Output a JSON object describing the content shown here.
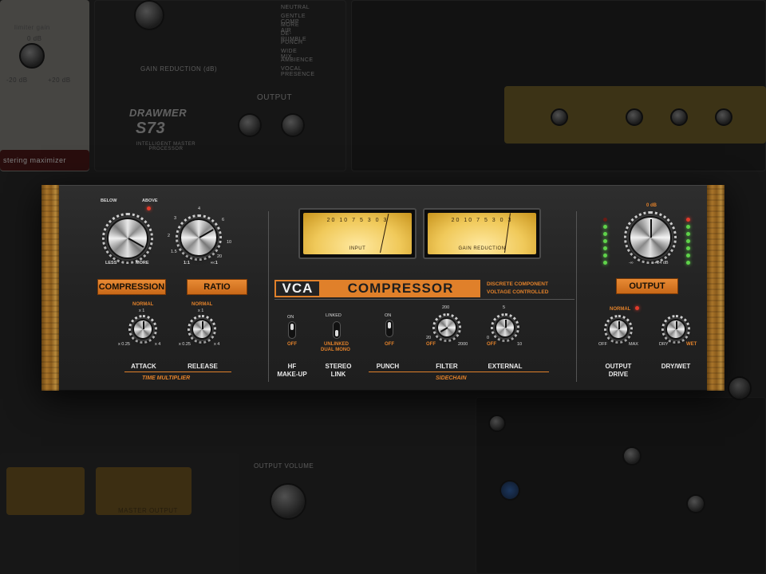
{
  "colors": {
    "accent": "#e0802a",
    "plate": "#d9762a",
    "led_green": "#5fd34a",
    "led_red": "#e23b2b",
    "meter": "#f0c95a"
  },
  "background": {
    "limiter_gain": "limiter gain",
    "limiter_gain_value": "0 dB",
    "limiter_minus": "-20 dB",
    "limiter_plus": "+20 dB",
    "mastering": "stering maximizer",
    "drawmer": "DRAWMER",
    "drawmer_model": "S73",
    "drawmer_sub": "INTELLIGENT MASTER PROCESSOR",
    "gain_reduction": "GAIN REDUCTION (dB)",
    "output": "OUTPUT",
    "presets": [
      "NEUTRAL",
      "GENTLE COMP",
      "MORE AIR",
      "DE-RUMBLE",
      "PUNCH",
      "WIDE MIX",
      "AMBIENCE",
      "VOCAL PRESENCE"
    ],
    "output_volume": "OUTPUT VOLUME",
    "master_output": "MASTER OUTPUT"
  },
  "plugin": {
    "compression": {
      "label": "COMPRESSION",
      "below": "BELOW",
      "above": "ABOVE",
      "less": "LESS",
      "more": "MORE"
    },
    "ratio": {
      "label": "RATIO",
      "ticks": [
        "1.5",
        "2",
        "3",
        "4",
        "6",
        "10",
        "20",
        "1:1",
        "∞:1"
      ]
    },
    "attack": {
      "label": "ATTACK",
      "normal": "NORMAL",
      "x1": "x 1",
      "min": "x 0.25",
      "max": "x 4"
    },
    "release": {
      "label": "RELEASE",
      "normal": "NORMAL",
      "x1": "x 1",
      "min": "x 0.25",
      "max": "x 4"
    },
    "time_multiplier": "TIME MULTIPLIER",
    "meters": {
      "input": {
        "label": "INPUT",
        "scale": "20 10 7 5 3 0 3"
      },
      "gr": {
        "label": "GAIN REDUCTION",
        "scale": "20 10 7 5 3 0 3"
      }
    },
    "title_vca": "VCA",
    "title_comp": "COMPRESSOR",
    "subtitle_1": "DISCRETE COMPONENT",
    "subtitle_2": "VOLTAGE CONTROLLED",
    "hf": {
      "on": "ON",
      "off": "OFF",
      "label_1": "HF",
      "label_2": "MAKE-UP"
    },
    "stereo": {
      "linked": "LINKED",
      "unlinked_1": "UNLINKED",
      "unlinked_2": "DUAL MONO",
      "label_1": "STEREO",
      "label_2": "LINK"
    },
    "punch": {
      "on": "ON",
      "off": "OFF",
      "label": "PUNCH"
    },
    "filter": {
      "top": "200",
      "left": "20",
      "right": "2000",
      "off": "OFF",
      "label": "FILTER"
    },
    "external": {
      "top": "5",
      "left": "0",
      "right": "10",
      "off": "OFF",
      "label": "EXTERNAL"
    },
    "sidechain": "SIDECHAIN",
    "output": {
      "label": "OUTPUT",
      "top": "0 dB",
      "left": "-∞",
      "right": "+24 dB"
    },
    "drive": {
      "normal": "NORMAL",
      "off": "OFF",
      "max": "MAX",
      "label_1": "OUTPUT",
      "label_2": "DRIVE"
    },
    "drywet": {
      "dry": "DRY",
      "wet": "WET",
      "label": "DRY/WET"
    }
  }
}
